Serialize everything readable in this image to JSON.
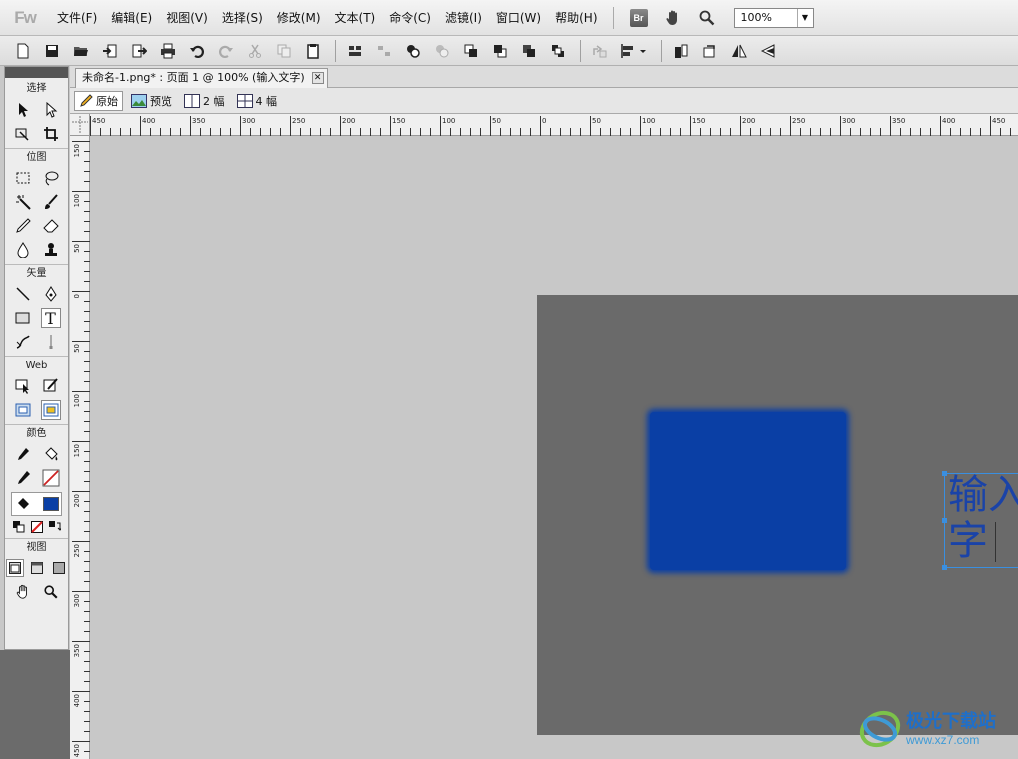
{
  "app": {
    "logo": "Fw"
  },
  "menubar": {
    "items": [
      {
        "label": "文件(F)",
        "name": "menu-file"
      },
      {
        "label": "编辑(E)",
        "name": "menu-edit"
      },
      {
        "label": "视图(V)",
        "name": "menu-view"
      },
      {
        "label": "选择(S)",
        "name": "menu-select"
      },
      {
        "label": "修改(M)",
        "name": "menu-modify"
      },
      {
        "label": "文本(T)",
        "name": "menu-text"
      },
      {
        "label": "命令(C)",
        "name": "menu-commands"
      },
      {
        "label": "滤镜(I)",
        "name": "menu-filters"
      },
      {
        "label": "窗口(W)",
        "name": "menu-window"
      },
      {
        "label": "帮助(H)",
        "name": "menu-help"
      }
    ],
    "bridge_badge": "Br",
    "zoom_value": "100%"
  },
  "tools_panel": {
    "sections": {
      "select": "选择",
      "bitmap": "位图",
      "vector": "矢量",
      "web": "Web",
      "colors": "颜色",
      "view": "视图"
    },
    "text_tool_glyph": "T",
    "stroke_color": "#cc2222",
    "fill_color": "#0a3fa5"
  },
  "document": {
    "tab_title": "未命名-1.png* : 页面 1 @ 100% (输入文字)",
    "close_glyph": "✕"
  },
  "view_tabs": [
    {
      "label": "原始",
      "name": "tab-original",
      "icon": "pencil-icon",
      "active": true
    },
    {
      "label": "预览",
      "name": "tab-preview",
      "icon": "image-icon",
      "active": false
    },
    {
      "label": "2 幅",
      "name": "tab-2up",
      "icon": "two-panel-icon",
      "active": false
    },
    {
      "label": "4 幅",
      "name": "tab-4up",
      "icon": "four-panel-icon",
      "active": false
    }
  ],
  "rulers": {
    "horizontal_labels": [
      "450",
      "400",
      "350",
      "300",
      "250",
      "200",
      "150",
      "100",
      "50",
      "0",
      "50",
      "100",
      "150",
      "200",
      "250",
      "300",
      "350",
      "400",
      "450"
    ],
    "vertical_labels": [
      "150",
      "100",
      "50",
      "0",
      "50",
      "100",
      "150",
      "200",
      "250",
      "300",
      "350",
      "400",
      "450"
    ]
  },
  "canvas": {
    "background": "#6a6a6a",
    "rect_color": "#0a3fa5",
    "text_lines": "输入\n字",
    "text_color": "#1a43a8"
  },
  "watermark": {
    "title": "极光下载站",
    "url": "www.xz7.com"
  }
}
